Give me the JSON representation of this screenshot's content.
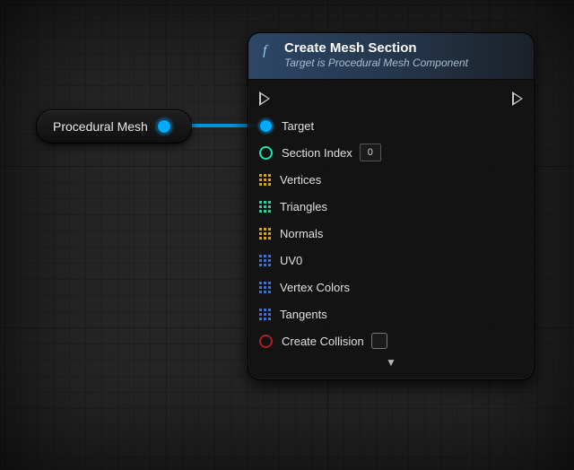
{
  "source_node": {
    "label": "Procedural Mesh"
  },
  "node": {
    "title": "Create Mesh Section",
    "subtitle": "Target is Procedural Mesh Component",
    "pins": {
      "target": {
        "label": "Target"
      },
      "section_index": {
        "label": "Section Index",
        "value": "0"
      },
      "vertices": {
        "label": "Vertices",
        "color": "#d8a300"
      },
      "triangles": {
        "label": "Triangles",
        "color": "#1fd3a6"
      },
      "normals": {
        "label": "Normals",
        "color": "#d8a300"
      },
      "uv0": {
        "label": "UV0",
        "color": "#3a6fe0"
      },
      "vertex_colors": {
        "label": "Vertex Colors",
        "color": "#3a6fe0"
      },
      "tangents": {
        "label": "Tangents",
        "color": "#3a6fe0"
      },
      "create_collision": {
        "label": "Create Collision"
      }
    }
  }
}
